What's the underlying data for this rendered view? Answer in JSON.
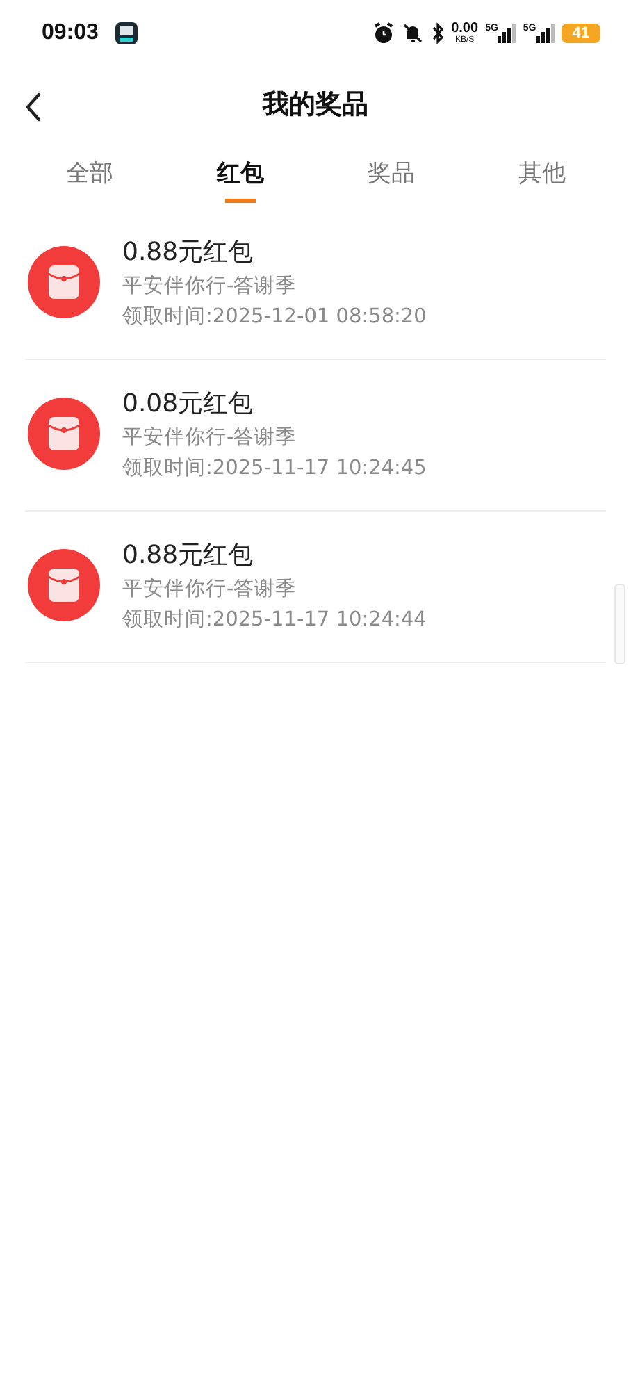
{
  "status_bar": {
    "time": "09:03",
    "net_speed": "0.00",
    "net_unit": "KB/S",
    "signals": [
      {
        "label": "5G"
      },
      {
        "label": "5G"
      }
    ],
    "battery": "41"
  },
  "header": {
    "title": "我的奖品"
  },
  "tabs": [
    {
      "label": "全部",
      "selected": false
    },
    {
      "label": "红包",
      "selected": true
    },
    {
      "label": "奖品",
      "selected": false
    },
    {
      "label": "其他",
      "selected": false
    }
  ],
  "prizes": [
    {
      "title": "0.88元红包",
      "source": "平安伴你行-答谢季",
      "time": "领取时间:2025-12-01 08:58:20"
    },
    {
      "title": "0.08元红包",
      "source": "平安伴你行-答谢季",
      "time": "领取时间:2025-11-17 10:24:45"
    },
    {
      "title": "0.88元红包",
      "source": "平安伴你行-答谢季",
      "time": "领取时间:2025-11-17 10:24:44"
    }
  ]
}
